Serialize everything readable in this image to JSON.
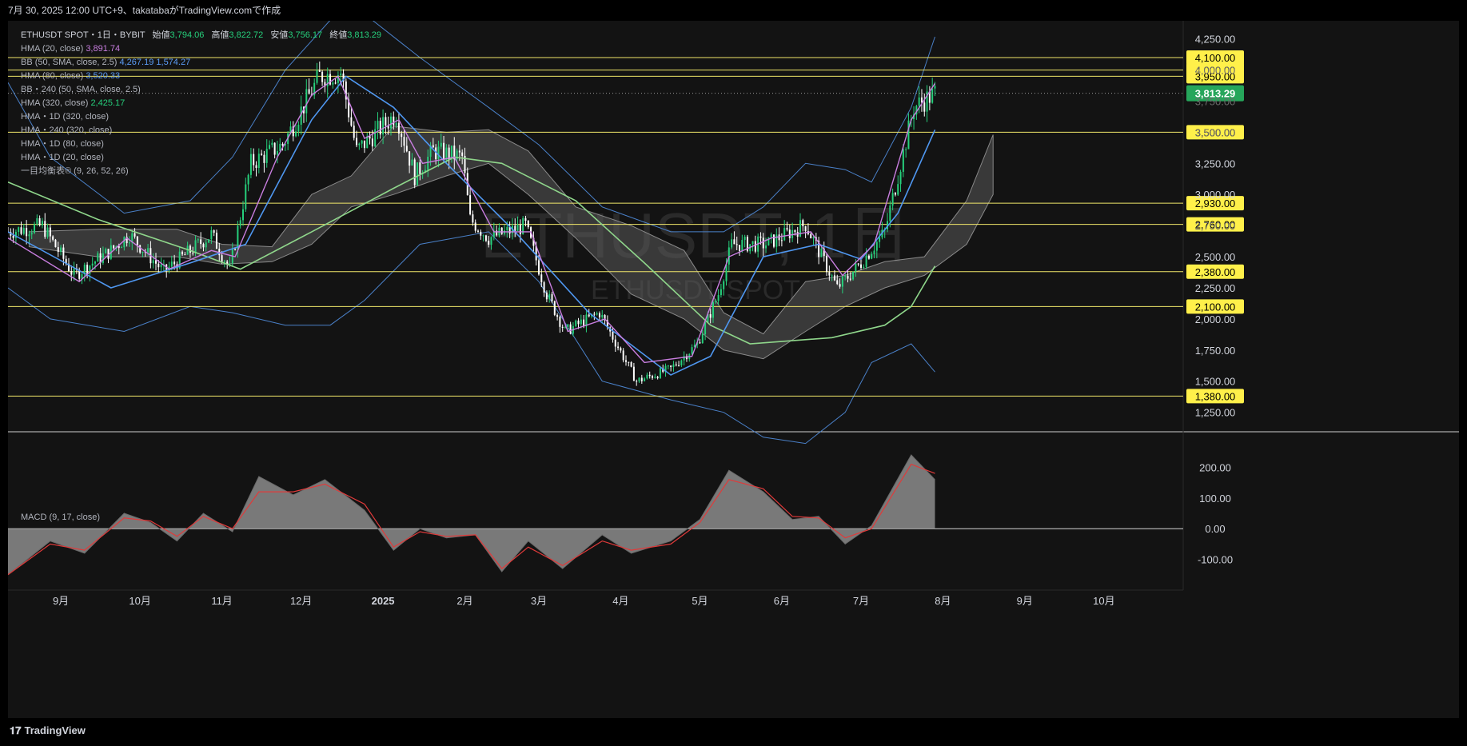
{
  "header": {
    "caption": "7月 30, 2025 12:00 UTC+9、takatabaがTradingView.comで作成"
  },
  "footer": {
    "brand": "TradingView",
    "logo_icon": "tradingview-logo-icon"
  },
  "legend": {
    "symbol_line": "ETHUSDT SPOT・1日・BYBIT",
    "open_label": "始値",
    "open": "3,794.06",
    "high_label": "高値",
    "high": "3,822.72",
    "low_label": "安値",
    "low": "3,756.17",
    "close_label": "終値",
    "close": "3,813.29",
    "indicators": [
      {
        "label": "HMA (20, close)",
        "value": "3,891.74",
        "color": "#c97ee0"
      },
      {
        "label": "BB (50, SMA, close, 2.5)",
        "value": "4,267.19",
        "value2": "1,574.27",
        "color": "#5b9cf6"
      },
      {
        "label": "HMA (80, close)",
        "value": "3,520.33",
        "color": "#5b9cf6"
      },
      {
        "label": "BB・240 (50, SMA, close, 2.5)",
        "value": "",
        "color": "#8a8a8a"
      },
      {
        "label": "HMA (320, close)",
        "value": "2,425.17",
        "color": "#8fd68b"
      },
      {
        "label": "HMA・1D (320, close)",
        "value": "",
        "color": "#8a8a8a"
      },
      {
        "label": "HMA・240 (320, close)",
        "value": "",
        "color": "#8a8a8a"
      },
      {
        "label": "HMA・1D (80, close)",
        "value": "",
        "color": "#8a8a8a"
      },
      {
        "label": "HMA・1D (20, close)",
        "value": "",
        "color": "#8a8a8a"
      },
      {
        "label": "一目均衡表® (9, 26, 52, 26)",
        "value": "",
        "color": "#8a8a8a"
      }
    ]
  },
  "watermark": {
    "main": "ETHUSDT, 1日",
    "sub": "ETHUSDT SPOT"
  },
  "colors": {
    "background": "#131313",
    "up": "#26d07c",
    "down": "#ffffff",
    "hline": "#f0e66a",
    "hline_label_bg": "#fff04a",
    "last_price_bg": "#26a65b",
    "bb": "#4a80c8",
    "hma20": "#c97ee0",
    "hma80": "#4f97f0",
    "hma320": "#8fd68b",
    "cloud": "#5a5a5a",
    "macd_hist": "#8c8c8c",
    "macd_signal": "#e03a3a"
  },
  "chart_data": [
    {
      "type": "candlestick",
      "symbol": "ETHUSDT SPOT",
      "timeframe": "1日",
      "x_range": [
        "2024-08-12",
        "2025-10-31"
      ],
      "ylim": [
        1100,
        4280
      ],
      "y_ticks": [
        "4,250.00",
        "4,000.00",
        "3,750.00",
        "3,500.00",
        "3,250.00",
        "3,000.00",
        "2,750.00",
        "2,500.00",
        "2,250.00",
        "2,000.00",
        "1,750.00",
        "1,500.00",
        "1,250.00"
      ],
      "y_tick_values": [
        4250,
        4000,
        3750,
        3500,
        3250,
        3000,
        2750,
        2500,
        2250,
        2000,
        1750,
        1500,
        1250
      ],
      "x_ticks": [
        {
          "label": "9月",
          "date": "2024-09-01"
        },
        {
          "label": "10月",
          "date": "2024-10-01"
        },
        {
          "label": "11月",
          "date": "2024-11-01"
        },
        {
          "label": "12月",
          "date": "2024-12-01"
        },
        {
          "label": "2025",
          "date": "2025-01-01",
          "bold": true
        },
        {
          "label": "2月",
          "date": "2025-02-01"
        },
        {
          "label": "3月",
          "date": "2025-03-01"
        },
        {
          "label": "4月",
          "date": "2025-04-01"
        },
        {
          "label": "5月",
          "date": "2025-05-01"
        },
        {
          "label": "6月",
          "date": "2025-06-01"
        },
        {
          "label": "7月",
          "date": "2025-07-01"
        },
        {
          "label": "8月",
          "date": "2025-08-01"
        },
        {
          "label": "9月",
          "date": "2025-09-01"
        },
        {
          "label": "10月",
          "date": "2025-10-01"
        }
      ],
      "last_price": {
        "label": "3,813.29",
        "value": 3813.29
      },
      "horizontal_lines": [
        {
          "label": "4,100.00",
          "value": 4100
        },
        {
          "label": "4,000.00",
          "value": 4000
        },
        {
          "label": "3,950.00",
          "value": 3950
        },
        {
          "label": "3,500.00",
          "value": 3500
        },
        {
          "label": "2,930.00",
          "value": 2930
        },
        {
          "label": "2,760.00",
          "value": 2760
        },
        {
          "label": "2,380.00",
          "value": 2380
        },
        {
          "label": "2,100.00",
          "value": 2100
        },
        {
          "label": "1,380.00",
          "value": 1380
        }
      ],
      "price_path": [
        [
          "2024-08-12",
          2700
        ],
        [
          "2024-08-25",
          2750
        ],
        [
          "2024-09-06",
          2350
        ],
        [
          "2024-09-20",
          2550
        ],
        [
          "2024-09-27",
          2680
        ],
        [
          "2024-10-10",
          2380
        ],
        [
          "2024-10-28",
          2680
        ],
        [
          "2024-11-04",
          2400
        ],
        [
          "2024-11-12",
          3250
        ],
        [
          "2024-11-24",
          3400
        ],
        [
          "2024-12-08",
          3950
        ],
        [
          "2024-12-16",
          3980
        ],
        [
          "2024-12-22",
          3350
        ],
        [
          "2025-01-06",
          3650
        ],
        [
          "2025-01-13",
          3150
        ],
        [
          "2025-01-20",
          3350
        ],
        [
          "2025-01-31",
          3300
        ],
        [
          "2025-02-03",
          2800
        ],
        [
          "2025-02-10",
          2650
        ],
        [
          "2025-02-24",
          2750
        ],
        [
          "2025-03-04",
          2200
        ],
        [
          "2025-03-11",
          1900
        ],
        [
          "2025-03-24",
          2050
        ],
        [
          "2025-04-07",
          1500
        ],
        [
          "2025-04-20",
          1600
        ],
        [
          "2025-04-30",
          1800
        ],
        [
          "2025-05-08",
          2200
        ],
        [
          "2025-05-13",
          2600
        ],
        [
          "2025-05-26",
          2600
        ],
        [
          "2025-06-10",
          2760
        ],
        [
          "2025-06-22",
          2250
        ],
        [
          "2025-07-01",
          2450
        ],
        [
          "2025-07-10",
          2700
        ],
        [
          "2025-07-21",
          3700
        ],
        [
          "2025-07-29",
          3813.29
        ]
      ],
      "hma20": [
        [
          "2024-08-12",
          2650
        ],
        [
          "2024-09-08",
          2300
        ],
        [
          "2024-09-26",
          2650
        ],
        [
          "2024-10-12",
          2400
        ],
        [
          "2024-10-28",
          2550
        ],
        [
          "2024-11-06",
          2500
        ],
        [
          "2024-11-22",
          3300
        ],
        [
          "2024-12-05",
          3800
        ],
        [
          "2024-12-15",
          3950
        ],
        [
          "2024-12-25",
          3450
        ],
        [
          "2025-01-07",
          3600
        ],
        [
          "2025-01-16",
          3250
        ],
        [
          "2025-01-28",
          3300
        ],
        [
          "2025-02-12",
          2700
        ],
        [
          "2025-02-26",
          2700
        ],
        [
          "2025-03-12",
          1900
        ],
        [
          "2025-03-26",
          2000
        ],
        [
          "2025-04-10",
          1650
        ],
        [
          "2025-04-28",
          1700
        ],
        [
          "2025-05-12",
          2500
        ],
        [
          "2025-05-28",
          2650
        ],
        [
          "2025-06-12",
          2700
        ],
        [
          "2025-06-24",
          2350
        ],
        [
          "2025-07-06",
          2600
        ],
        [
          "2025-07-20",
          3600
        ],
        [
          "2025-07-29",
          3891.74
        ]
      ],
      "hma80": [
        [
          "2024-08-12",
          2700
        ],
        [
          "2024-09-20",
          2250
        ],
        [
          "2024-10-20",
          2450
        ],
        [
          "2024-11-10",
          2600
        ],
        [
          "2024-12-05",
          3600
        ],
        [
          "2024-12-18",
          3950
        ],
        [
          "2025-01-05",
          3700
        ],
        [
          "2025-01-25",
          3250
        ],
        [
          "2025-02-20",
          2700
        ],
        [
          "2025-03-20",
          2050
        ],
        [
          "2025-04-20",
          1550
        ],
        [
          "2025-05-05",
          1700
        ],
        [
          "2025-05-25",
          2500
        ],
        [
          "2025-06-15",
          2600
        ],
        [
          "2025-07-01",
          2480
        ],
        [
          "2025-07-15",
          2850
        ],
        [
          "2025-07-29",
          3520.33
        ]
      ],
      "hma320": [
        [
          "2024-08-12",
          3100
        ],
        [
          "2024-09-15",
          2800
        ],
        [
          "2024-10-20",
          2550
        ],
        [
          "2024-11-08",
          2400
        ],
        [
          "2024-12-05",
          2700
        ],
        [
          "2025-01-05",
          3050
        ],
        [
          "2025-01-28",
          3300
        ],
        [
          "2025-02-15",
          3250
        ],
        [
          "2025-03-15",
          2950
        ],
        [
          "2025-04-10",
          2450
        ],
        [
          "2025-05-05",
          1950
        ],
        [
          "2025-05-20",
          1800
        ],
        [
          "2025-06-20",
          1850
        ],
        [
          "2025-07-10",
          1950
        ],
        [
          "2025-07-20",
          2100
        ],
        [
          "2025-07-29",
          2425.17
        ]
      ],
      "bb_upper": [
        [
          "2024-08-12",
          3900
        ],
        [
          "2024-08-28",
          3300
        ],
        [
          "2024-09-25",
          2850
        ],
        [
          "2024-10-20",
          2950
        ],
        [
          "2024-11-05",
          3300
        ],
        [
          "2024-11-25",
          4000
        ],
        [
          "2024-12-12",
          4400
        ],
        [
          "2024-12-25",
          4450
        ],
        [
          "2025-01-15",
          4100
        ],
        [
          "2025-02-10",
          3700
        ],
        [
          "2025-03-01",
          3400
        ],
        [
          "2025-03-25",
          2900
        ],
        [
          "2025-04-20",
          2700
        ],
        [
          "2025-05-10",
          2700
        ],
        [
          "2025-05-25",
          2900
        ],
        [
          "2025-06-10",
          3250
        ],
        [
          "2025-06-25",
          3200
        ],
        [
          "2025-07-05",
          3100
        ],
        [
          "2025-07-20",
          3700
        ],
        [
          "2025-07-29",
          4267.19
        ]
      ],
      "bb_lower": [
        [
          "2024-08-12",
          2250
        ],
        [
          "2024-08-28",
          2000
        ],
        [
          "2024-09-25",
          1900
        ],
        [
          "2024-10-20",
          2100
        ],
        [
          "2024-11-05",
          2050
        ],
        [
          "2024-11-25",
          1950
        ],
        [
          "2024-12-12",
          1950
        ],
        [
          "2024-12-25",
          2150
        ],
        [
          "2025-01-15",
          2600
        ],
        [
          "2025-02-10",
          2700
        ],
        [
          "2025-03-01",
          2300
        ],
        [
          "2025-03-25",
          1500
        ],
        [
          "2025-04-20",
          1350
        ],
        [
          "2025-05-10",
          1250
        ],
        [
          "2025-05-25",
          1050
        ],
        [
          "2025-06-10",
          1000
        ],
        [
          "2025-06-25",
          1250
        ],
        [
          "2025-07-05",
          1650
        ],
        [
          "2025-07-20",
          1800
        ],
        [
          "2025-07-29",
          1574.27
        ]
      ],
      "cloud": [
        [
          "2024-08-20",
          2700,
          2580
        ],
        [
          "2024-09-15",
          2720,
          2500
        ],
        [
          "2024-10-15",
          2720,
          2500
        ],
        [
          "2024-11-01",
          2600,
          2440
        ],
        [
          "2024-11-20",
          2580,
          2460
        ],
        [
          "2024-12-05",
          3000,
          2600
        ],
        [
          "2024-12-20",
          3150,
          2900
        ],
        [
          "2025-01-05",
          3550,
          3000
        ],
        [
          "2025-01-25",
          3500,
          3150
        ],
        [
          "2025-02-10",
          3520,
          3250
        ],
        [
          "2025-02-25",
          3350,
          3000
        ],
        [
          "2025-03-15",
          2900,
          2650
        ],
        [
          "2025-04-05",
          2750,
          2200
        ],
        [
          "2025-04-25",
          2550,
          2000
        ],
        [
          "2025-05-10",
          2050,
          1750
        ],
        [
          "2025-05-25",
          1880,
          1680
        ],
        [
          "2025-06-10",
          2300,
          1900
        ],
        [
          "2025-06-25",
          2350,
          2100
        ],
        [
          "2025-07-10",
          2460,
          2250
        ],
        [
          "2025-07-25",
          2500,
          2350
        ],
        [
          "2025-08-10",
          2950,
          2600
        ],
        [
          "2025-08-20",
          3480,
          3000
        ]
      ]
    },
    {
      "type": "area",
      "title": "MACD (9, 17, close)",
      "ylim": [
        -200,
        300
      ],
      "y_ticks": [
        "200.00",
        "100.00",
        "0.00",
        "-100.00"
      ],
      "y_tick_values": [
        200,
        100,
        0,
        -100
      ],
      "series": [
        {
          "name": "MACD",
          "points": [
            [
              "2024-08-12",
              -150
            ],
            [
              "2024-08-28",
              -40
            ],
            [
              "2024-09-10",
              -80
            ],
            [
              "2024-09-25",
              50
            ],
            [
              "2024-10-05",
              20
            ],
            [
              "2024-10-15",
              -40
            ],
            [
              "2024-10-25",
              50
            ],
            [
              "2024-11-05",
              -10
            ],
            [
              "2024-11-15",
              170
            ],
            [
              "2024-11-28",
              110
            ],
            [
              "2024-12-10",
              160
            ],
            [
              "2024-12-25",
              60
            ],
            [
              "2025-01-05",
              -70
            ],
            [
              "2025-01-15",
              0
            ],
            [
              "2025-01-25",
              -30
            ],
            [
              "2025-02-05",
              -20
            ],
            [
              "2025-02-15",
              -140
            ],
            [
              "2025-02-25",
              -40
            ],
            [
              "2025-03-10",
              -130
            ],
            [
              "2025-03-25",
              -20
            ],
            [
              "2025-04-05",
              -80
            ],
            [
              "2025-04-20",
              -40
            ],
            [
              "2025-05-01",
              30
            ],
            [
              "2025-05-12",
              190
            ],
            [
              "2025-05-25",
              120
            ],
            [
              "2025-06-05",
              30
            ],
            [
              "2025-06-15",
              40
            ],
            [
              "2025-06-25",
              -50
            ],
            [
              "2025-07-05",
              10
            ],
            [
              "2025-07-20",
              240
            ],
            [
              "2025-07-29",
              160
            ]
          ]
        },
        {
          "name": "Signal",
          "points": [
            [
              "2024-08-12",
              -150
            ],
            [
              "2024-08-28",
              -50
            ],
            [
              "2024-09-10",
              -70
            ],
            [
              "2024-09-25",
              35
            ],
            [
              "2024-10-05",
              25
            ],
            [
              "2024-10-15",
              -25
            ],
            [
              "2024-10-25",
              40
            ],
            [
              "2024-11-05",
              0
            ],
            [
              "2024-11-15",
              120
            ],
            [
              "2024-11-28",
              120
            ],
            [
              "2024-12-10",
              145
            ],
            [
              "2024-12-25",
              80
            ],
            [
              "2025-01-05",
              -60
            ],
            [
              "2025-01-15",
              -10
            ],
            [
              "2025-01-25",
              -25
            ],
            [
              "2025-02-05",
              -20
            ],
            [
              "2025-02-15",
              -130
            ],
            [
              "2025-02-25",
              -60
            ],
            [
              "2025-03-10",
              -120
            ],
            [
              "2025-03-25",
              -40
            ],
            [
              "2025-04-05",
              -70
            ],
            [
              "2025-04-20",
              -50
            ],
            [
              "2025-05-01",
              20
            ],
            [
              "2025-05-12",
              160
            ],
            [
              "2025-05-25",
              130
            ],
            [
              "2025-06-05",
              40
            ],
            [
              "2025-06-15",
              35
            ],
            [
              "2025-06-25",
              -30
            ],
            [
              "2025-07-05",
              0
            ],
            [
              "2025-07-20",
              210
            ],
            [
              "2025-07-29",
              180
            ]
          ]
        }
      ]
    }
  ]
}
